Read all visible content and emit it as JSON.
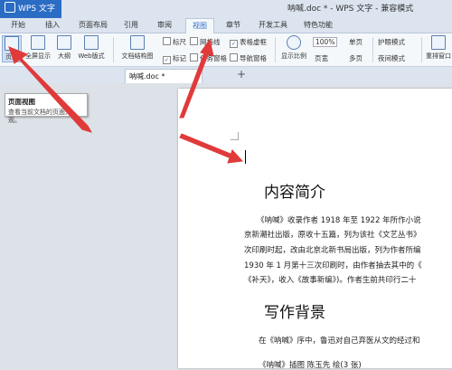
{
  "app": {
    "name": "WPS 文字",
    "window_title": "呐喊.doc * - WPS 文字 - 兼容模式"
  },
  "menu_tabs": [
    "开始",
    "插入",
    "页面布局",
    "引用",
    "审阅",
    "视图",
    "章节",
    "开发工具",
    "特色功能"
  ],
  "ribbon": {
    "page_view": "页面",
    "full_screen": "全屏显示",
    "outline": "大纲",
    "web_layout": "Web版式",
    "doc_structure": "文档结构图",
    "ruler": "标尺",
    "gridlines": "网格线",
    "table_borders": "表格虚框",
    "marks": "标记",
    "task_pane": "任务窗格",
    "nav_pane": "导航窗格",
    "show_ratio": "显示比例",
    "zoom": "100%",
    "page_width": "页宽",
    "single_page": "单页",
    "multi_page": "多页",
    "eye_mode": "护眼模式",
    "night_mode": "夜间模式",
    "rearrange": "重排窗口"
  },
  "doc_tab": {
    "label": "呐喊.doc *"
  },
  "tooltip": {
    "title": "页面视图",
    "desc_line1": "查看当前文档的页面外",
    "desc_line2": "观。"
  },
  "document": {
    "heading1": "内容简介",
    "para1_l1": "《呐喊》收录作者 1918 年至 1922 年所作小说",
    "para1_l2": "京新潮社出版，原收十五篇，列为该社《文艺丛书》",
    "para1_l3": "次印刷时起，改由北京北新书局出版，列为作者所编",
    "para1_l4": "1930 年 1 月第十三次印刷时，由作者抽去其中的《",
    "para1_l5": "《补天》，收入《故事新编》)。作者生前共印行二十",
    "heading2": "写作背景",
    "para2_l1": "在《呐喊》序中，鲁迅对自己弃医从文的经过和",
    "para3_l1": "《呐喊》插图 陈玉先 绘(3 张)"
  },
  "colors": {
    "accent": "#2b6cc4",
    "arrow": "#e03a3a"
  }
}
